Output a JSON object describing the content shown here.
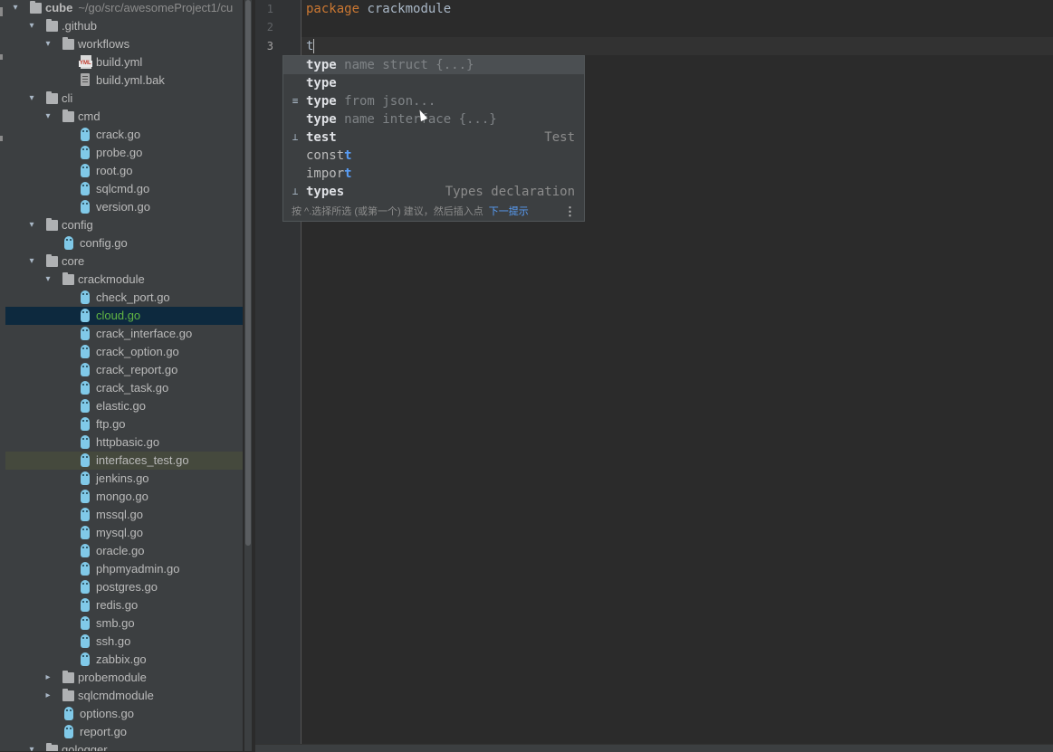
{
  "project": {
    "root_name": "cube",
    "root_path": "~/go/src/awesomeProject1/cu"
  },
  "tree": {
    "items": [
      {
        "label": "cube",
        "kind": "folder",
        "depth": 0,
        "expanded": true
      },
      {
        "label": ".github",
        "kind": "folder",
        "depth": 1,
        "expanded": true
      },
      {
        "label": "workflows",
        "kind": "folder",
        "depth": 2,
        "expanded": true
      },
      {
        "label": "build.yml",
        "kind": "yml",
        "depth": 3
      },
      {
        "label": "build.yml.bak",
        "kind": "bak",
        "depth": 3
      },
      {
        "label": "cli",
        "kind": "folder",
        "depth": 1,
        "expanded": true
      },
      {
        "label": "cmd",
        "kind": "folder",
        "depth": 2,
        "expanded": true
      },
      {
        "label": "crack.go",
        "kind": "go",
        "depth": 3
      },
      {
        "label": "probe.go",
        "kind": "go",
        "depth": 3
      },
      {
        "label": "root.go",
        "kind": "go",
        "depth": 3
      },
      {
        "label": "sqlcmd.go",
        "kind": "go",
        "depth": 3
      },
      {
        "label": "version.go",
        "kind": "go",
        "depth": 3
      },
      {
        "label": "config",
        "kind": "folder",
        "depth": 1,
        "expanded": true
      },
      {
        "label": "config.go",
        "kind": "go",
        "depth": 2
      },
      {
        "label": "core",
        "kind": "folder",
        "depth": 1,
        "expanded": true
      },
      {
        "label": "crackmodule",
        "kind": "folder",
        "depth": 2,
        "expanded": true
      },
      {
        "label": "check_port.go",
        "kind": "go",
        "depth": 3
      },
      {
        "label": "cloud.go",
        "kind": "go",
        "depth": 3,
        "state": "selected"
      },
      {
        "label": "crack_interface.go",
        "kind": "go",
        "depth": 3
      },
      {
        "label": "crack_option.go",
        "kind": "go",
        "depth": 3
      },
      {
        "label": "crack_report.go",
        "kind": "go",
        "depth": 3
      },
      {
        "label": "crack_task.go",
        "kind": "go",
        "depth": 3
      },
      {
        "label": "elastic.go",
        "kind": "go",
        "depth": 3
      },
      {
        "label": "ftp.go",
        "kind": "go",
        "depth": 3
      },
      {
        "label": "httpbasic.go",
        "kind": "go",
        "depth": 3
      },
      {
        "label": "interfaces_test.go",
        "kind": "go",
        "depth": 3,
        "state": "highlight"
      },
      {
        "label": "jenkins.go",
        "kind": "go",
        "depth": 3
      },
      {
        "label": "mongo.go",
        "kind": "go",
        "depth": 3
      },
      {
        "label": "mssql.go",
        "kind": "go",
        "depth": 3
      },
      {
        "label": "mysql.go",
        "kind": "go",
        "depth": 3
      },
      {
        "label": "oracle.go",
        "kind": "go",
        "depth": 3
      },
      {
        "label": "phpmyadmin.go",
        "kind": "go",
        "depth": 3
      },
      {
        "label": "postgres.go",
        "kind": "go",
        "depth": 3
      },
      {
        "label": "redis.go",
        "kind": "go",
        "depth": 3
      },
      {
        "label": "smb.go",
        "kind": "go",
        "depth": 3
      },
      {
        "label": "ssh.go",
        "kind": "go",
        "depth": 3
      },
      {
        "label": "zabbix.go",
        "kind": "go",
        "depth": 3
      },
      {
        "label": "probemodule",
        "kind": "folder",
        "depth": 2,
        "expanded": false
      },
      {
        "label": "sqlcmdmodule",
        "kind": "folder",
        "depth": 2,
        "expanded": false
      },
      {
        "label": "options.go",
        "kind": "go",
        "depth": 2
      },
      {
        "label": "report.go",
        "kind": "go",
        "depth": 2
      },
      {
        "label": "gologger",
        "kind": "folder",
        "depth": 1,
        "expanded": true
      }
    ]
  },
  "editor": {
    "line_numbers": [
      "1",
      "2",
      "3"
    ],
    "line1_keyword": "package",
    "line1_name": "crackmodule",
    "line3_text": "t"
  },
  "completion": {
    "items": [
      {
        "icon": "",
        "match": "type",
        "rest": "",
        "hint": " name struct {...}",
        "type": ""
      },
      {
        "icon": "",
        "match": "type",
        "rest": "",
        "hint": "",
        "type": ""
      },
      {
        "icon": "template-icon",
        "match": "type",
        "rest": "",
        "hint": " from json...",
        "type": ""
      },
      {
        "icon": "",
        "match": "type",
        "rest": "",
        "hint": " name interface {...}",
        "type": ""
      },
      {
        "icon": "test-icon",
        "match": "test",
        "rest": "",
        "hint": "",
        "type": "Test"
      },
      {
        "icon": "",
        "match": "",
        "rest": "const",
        "hint": "",
        "type": ""
      },
      {
        "icon": "",
        "match": "",
        "rest": "impor",
        "hint": "",
        "type": ""
      },
      {
        "icon": "test-icon",
        "match": "types",
        "rest": "",
        "hint": "",
        "type": "Types declaration"
      }
    ],
    "footer_text": "按 ^.选择所选 (或第一个) 建议，然后插入点",
    "footer_link": "下一提示",
    "colors": {
      "popup_bg": "#3c3f41",
      "selected_bg": "#4b4f52",
      "link": "#589df6"
    }
  }
}
